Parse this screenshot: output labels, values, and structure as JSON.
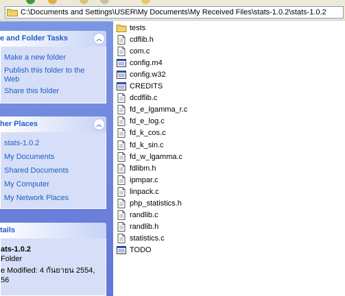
{
  "address": {
    "path": "C:\\Documents and Settings\\USER\\My Documents\\My Received Files\\stats-1.0.2\\stats-1.0.2"
  },
  "tasks_panel": {
    "title": "e and Folder Tasks",
    "links": [
      "Make a new folder",
      "Publish this folder to the Web",
      "Share this folder"
    ]
  },
  "places_panel": {
    "title": "her Places",
    "links": [
      "stats-1.0.2",
      "My Documents",
      "Shared Documents",
      "My Computer",
      "My Network Places"
    ]
  },
  "details_panel": {
    "title": "tails",
    "name": "ats-1.0.2",
    "type": "Folder",
    "modified_line1": "e Modified: 4 กันยายน 2554,",
    "modified_line2": "56"
  },
  "files": [
    {
      "name": "tests",
      "icon": "folder-icon"
    },
    {
      "name": "cdflib.h",
      "icon": "text-file-icon"
    },
    {
      "name": "com.c",
      "icon": "text-file-icon"
    },
    {
      "name": "config.m4",
      "icon": "app-file-icon"
    },
    {
      "name": "config.w32",
      "icon": "app-file-icon"
    },
    {
      "name": "CREDITS",
      "icon": "app-file-icon"
    },
    {
      "name": "dcdflib.c",
      "icon": "text-file-icon"
    },
    {
      "name": "fd_e_lgamma_r.c",
      "icon": "text-file-icon"
    },
    {
      "name": "fd_e_log.c",
      "icon": "text-file-icon"
    },
    {
      "name": "fd_k_cos.c",
      "icon": "text-file-icon"
    },
    {
      "name": "fd_k_sin.c",
      "icon": "text-file-icon"
    },
    {
      "name": "fd_w_lgamma.c",
      "icon": "text-file-icon"
    },
    {
      "name": "fdlibm.h",
      "icon": "text-file-icon"
    },
    {
      "name": "ipmpar.c",
      "icon": "text-file-icon"
    },
    {
      "name": "linpack.c",
      "icon": "text-file-icon"
    },
    {
      "name": "php_statistics.h",
      "icon": "text-file-icon"
    },
    {
      "name": "randlib.c",
      "icon": "text-file-icon"
    },
    {
      "name": "randlib.h",
      "icon": "text-file-icon"
    },
    {
      "name": "statistics.c",
      "icon": "text-file-icon"
    },
    {
      "name": "TODO",
      "icon": "app-file-icon"
    }
  ],
  "colors": {
    "task_pane_bg": "#6b86db",
    "panel_body_bg": "#d6dff7",
    "link_color": "#215dc6",
    "address_border": "#7f9db9"
  }
}
